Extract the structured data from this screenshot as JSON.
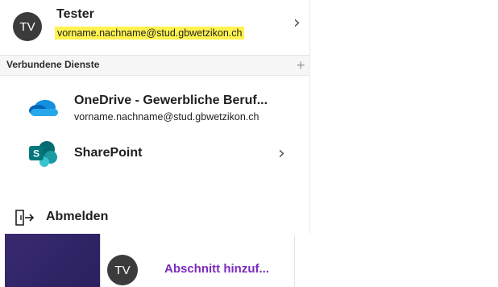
{
  "account": {
    "initials": "TV",
    "name": "Tester",
    "email": "vorname.nachname@stud.gbwetzikon.ch"
  },
  "connected_services": {
    "title": "Verbundene Dienste",
    "add_symbol": "+",
    "items": [
      {
        "name": "OneDrive - Gewerbliche Beruf...",
        "subtitle": "vorname.nachname@stud.gbwetzikon.ch",
        "icon": "onedrive-icon"
      },
      {
        "name": "SharePoint",
        "icon": "sharepoint-icon"
      }
    ]
  },
  "signout": {
    "label": "Abmelden",
    "icon": "sign-out-icon"
  },
  "bottom": {
    "avatar_initials": "TV",
    "add_section_label": "Abschnitt hinzuf..."
  },
  "colors": {
    "highlight": "#fff34f",
    "accent_purple": "#7b2bbd",
    "onedrive_blue": "#0f6cbd",
    "sharepoint_teal": "#038387"
  }
}
